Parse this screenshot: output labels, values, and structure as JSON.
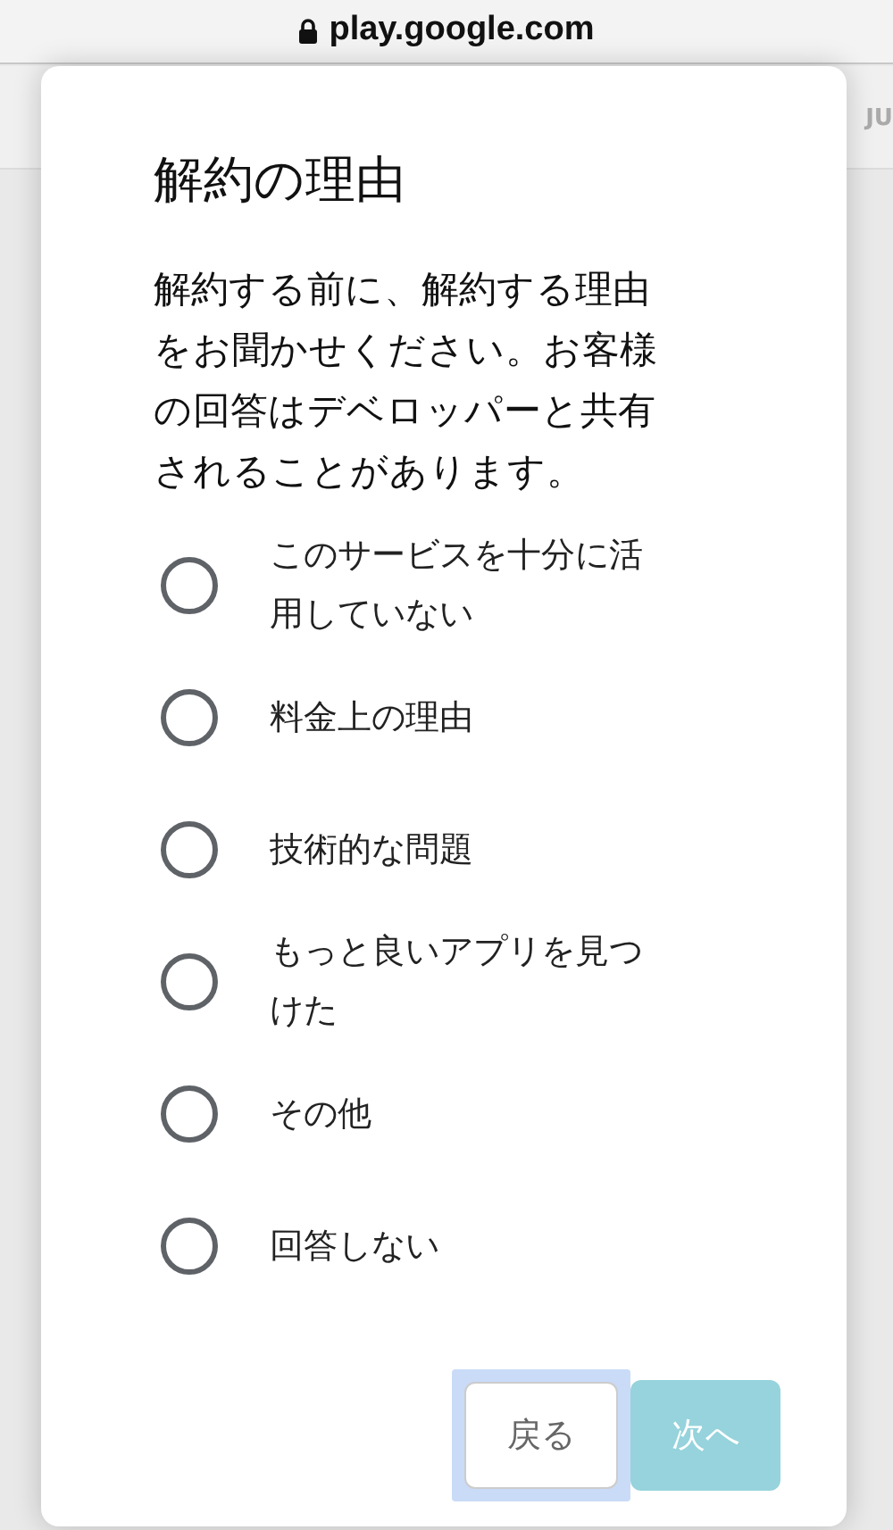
{
  "address_bar": {
    "url": "play.google.com"
  },
  "background": {
    "text_1": "JU"
  },
  "dialog": {
    "title": "解約の理由",
    "description": "解約する前に、解約する理由をお聞かせください。お客様の回答はデベロッパーと共有されることがあります。",
    "options": [
      {
        "label": "このサービスを十分に活用していない",
        "selected": false
      },
      {
        "label": "料金上の理由",
        "selected": false
      },
      {
        "label": "技術的な問題",
        "selected": false
      },
      {
        "label": "もっと良いアプリを見つけた",
        "selected": false
      },
      {
        "label": "その他",
        "selected": false
      },
      {
        "label": "回答しない",
        "selected": false
      }
    ],
    "back_button": {
      "label": "戻る",
      "focused": true
    },
    "next_button": {
      "label": "次へ",
      "disabled": true
    }
  }
}
